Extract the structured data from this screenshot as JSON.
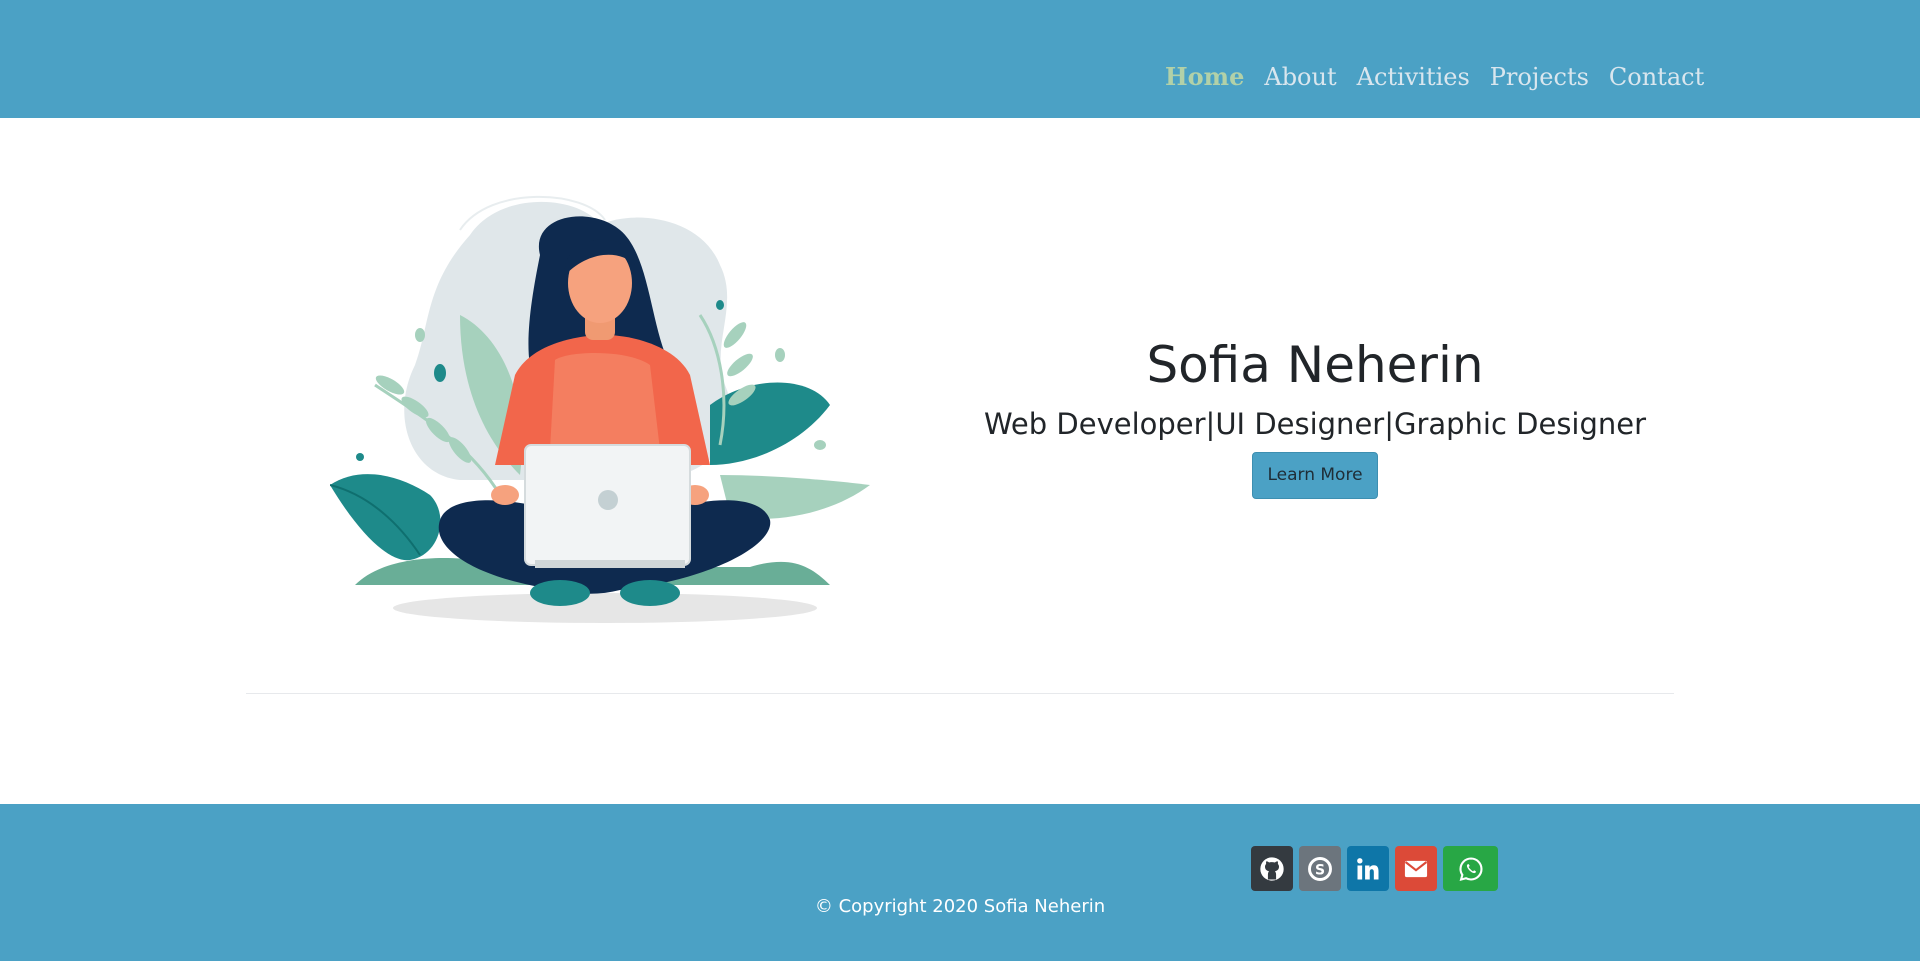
{
  "header": {
    "nav": [
      {
        "label": "Home",
        "active": true
      },
      {
        "label": "About",
        "active": false
      },
      {
        "label": "Activities",
        "active": false
      },
      {
        "label": "Projects",
        "active": false
      },
      {
        "label": "Contact",
        "active": false
      }
    ]
  },
  "hero": {
    "name": "Sofia Neherin",
    "subtitle": "Web Developer|UI Designer|Graphic Designer",
    "button_label": "Learn More",
    "illustration": "woman-with-laptop-illustration"
  },
  "footer": {
    "socials": [
      {
        "icon": "github-icon",
        "color": "#343a40"
      },
      {
        "icon": "skype-icon",
        "color": "#6c757d"
      },
      {
        "icon": "linkedin-icon",
        "color": "#0e76a8"
      },
      {
        "icon": "email-icon",
        "color": "#dc4a38"
      },
      {
        "icon": "whatsapp-icon",
        "color": "#28a745"
      }
    ],
    "copyright": "© Copyright 2020 Sofia Neherin"
  },
  "colors": {
    "brand": "#4ba1c5",
    "nav_active": "#b2d1a8",
    "nav_text": "#d9e6ee"
  }
}
